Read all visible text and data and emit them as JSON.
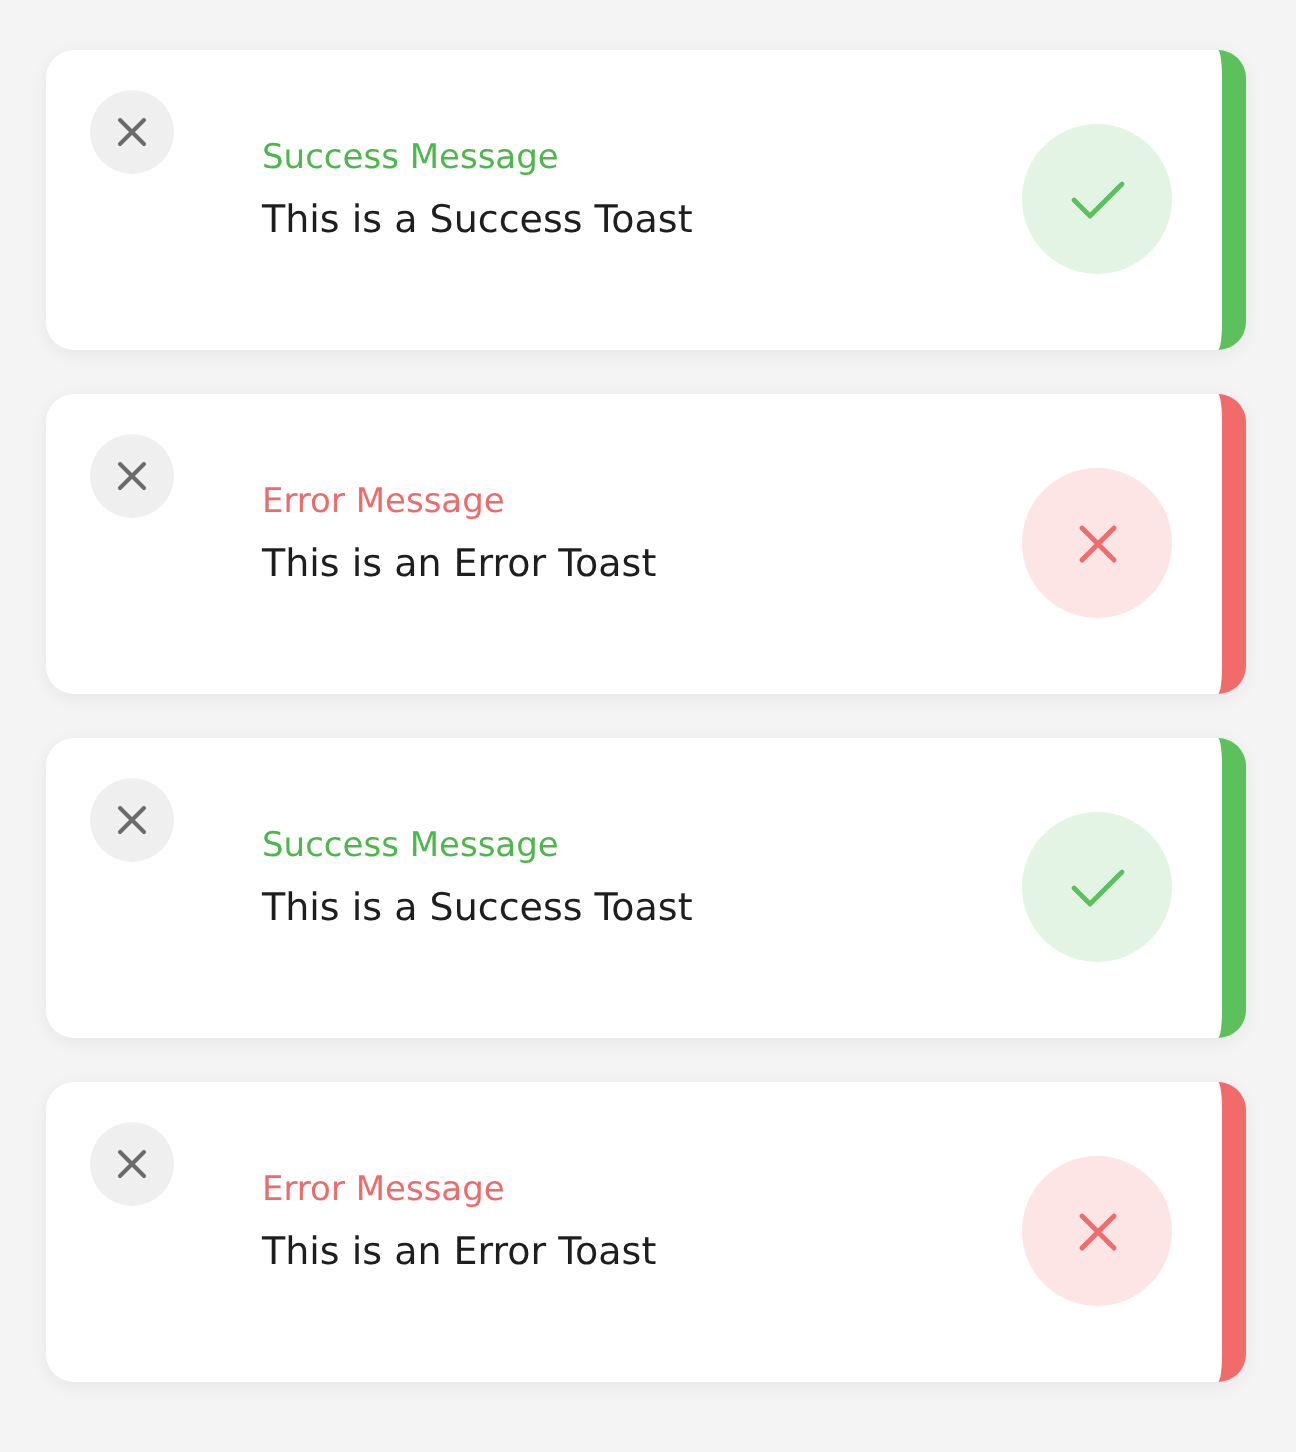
{
  "toasts": [
    {
      "kind": "success",
      "title": "Success Message",
      "message": "This is a Success Toast"
    },
    {
      "kind": "error",
      "title": "Error Message",
      "message": "This is an Error Toast"
    },
    {
      "kind": "success",
      "title": "Success Message",
      "message": "This is a Success Toast"
    },
    {
      "kind": "error",
      "title": "Error Message",
      "message": "This is an Error Toast"
    }
  ]
}
